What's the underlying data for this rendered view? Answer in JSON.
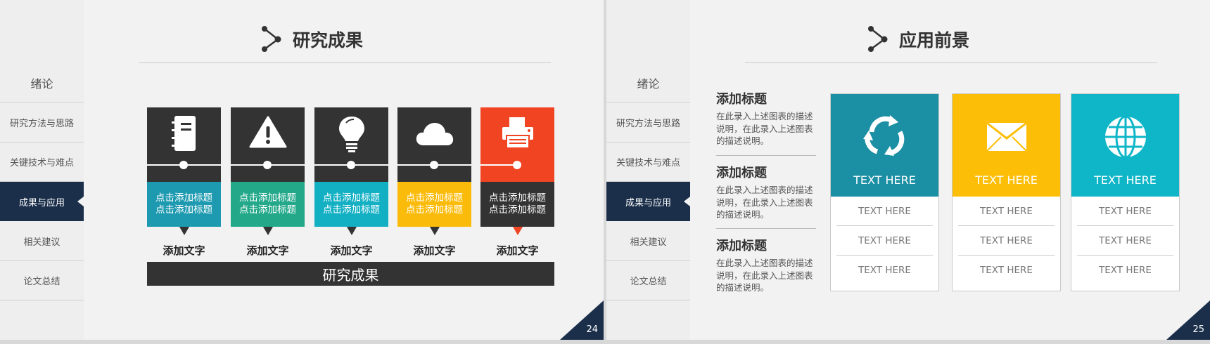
{
  "sidebar": {
    "items": [
      {
        "label": "绪论"
      },
      {
        "label": "研究方法与思路"
      },
      {
        "label": "关键技术与难点"
      },
      {
        "label": "成果与应用"
      },
      {
        "label": "相关建议"
      },
      {
        "label": "论文总结"
      }
    ],
    "active_index": 3
  },
  "slide1": {
    "title": "研究成果",
    "page_number": "24",
    "cards": [
      {
        "icon": "document-icon",
        "color": "#1d9ab0",
        "line1": "点击添加标题",
        "line2": "点击添加标题",
        "label": "添加文字"
      },
      {
        "icon": "warning-icon",
        "color": "#23a98a",
        "line1": "点击添加标题",
        "line2": "点击添加标题",
        "label": "添加文字"
      },
      {
        "icon": "lightbulb-icon",
        "color": "#13b0c4",
        "line1": "点击添加标题",
        "line2": "点击添加标题",
        "label": "添加文字"
      },
      {
        "icon": "cloud-icon",
        "color": "#fbbb0b",
        "line1": "点击添加标题",
        "line2": "点击添加标题",
        "label": "添加文字"
      },
      {
        "icon": "printer-icon",
        "color": "#333333",
        "line1": "点击添加标题",
        "line2": "点击添加标题",
        "label": "添加文字"
      }
    ],
    "bottom_bar": "研究成果"
  },
  "slide2": {
    "title": "应用前景",
    "page_number": "25",
    "text_blocks": [
      {
        "title": "添加标题",
        "body": "在此录入上述图表的描述说明，在此录入上述图表的描述说明。"
      },
      {
        "title": "添加标题",
        "body": "在此录入上述图表的描述说明，在此录入上述图表的描述说明。"
      },
      {
        "title": "添加标题",
        "body": "在此录入上述图表的描述说明，在此录入上述图表的描述说明。"
      }
    ],
    "columns": [
      {
        "icon": "recycle-icon",
        "color": "#1b8fa3",
        "heading": "TEXT HERE",
        "rows": [
          "TEXT HERE",
          "TEXT HERE",
          "TEXT HERE"
        ]
      },
      {
        "icon": "envelope-icon",
        "color": "#fdbe08",
        "heading": "TEXT HERE",
        "rows": [
          "TEXT HERE",
          "TEXT HERE",
          "TEXT HERE"
        ]
      },
      {
        "icon": "globe-icon",
        "color": "#0fb6c8",
        "heading": "TEXT HERE",
        "rows": [
          "TEXT HERE",
          "TEXT HERE",
          "TEXT HERE"
        ]
      }
    ]
  },
  "colors": {
    "navy": "#1b2f4a",
    "dark": "#333333",
    "red": "#f04423"
  }
}
